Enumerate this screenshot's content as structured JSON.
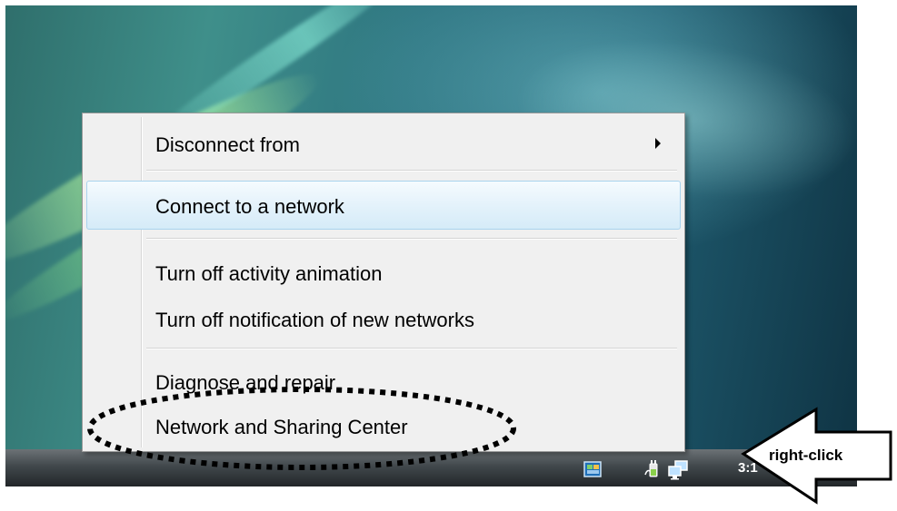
{
  "context_menu": {
    "items": [
      {
        "label": "Disconnect from",
        "has_submenu": true
      },
      {
        "label": "Connect to a network",
        "highlighted": true
      },
      {
        "label": "Turn off activity animation"
      },
      {
        "label": "Turn off notification of new networks"
      },
      {
        "label": "Diagnose and repair"
      },
      {
        "label": "Network and Sharing Center",
        "circled": true
      }
    ]
  },
  "taskbar": {
    "tray_icons": [
      "windows-sidebar-icon",
      "power-plug-icon",
      "network-icon"
    ],
    "clock_partial": "3:1"
  },
  "annotation": {
    "callout_label": "right-click",
    "highlight_target": "Network and Sharing Center"
  },
  "colors": {
    "menu_background": "#f0f0f0",
    "menu_highlight": "#d5ebf8",
    "annotation": "#000000"
  }
}
